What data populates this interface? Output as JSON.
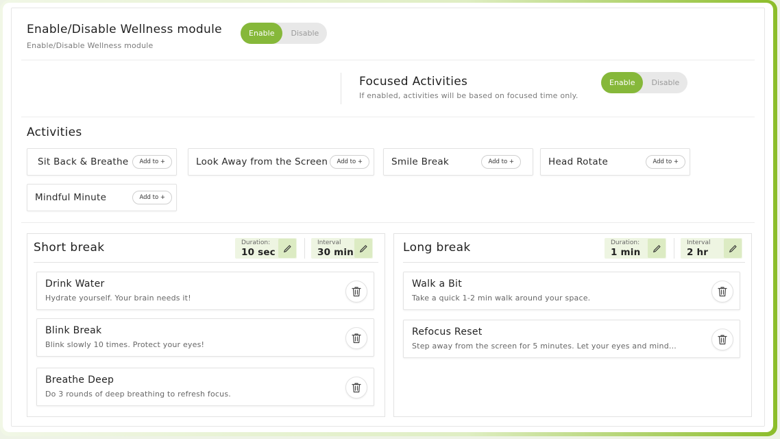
{
  "module": {
    "title": "Enable/Disable Wellness module",
    "subtitle": "Enable/Disable Wellness module",
    "toggle": {
      "enable_label": "Enable",
      "disable_label": "Disable",
      "selected": "Enable"
    }
  },
  "focused": {
    "title": "Focused Activities",
    "subtitle": "If enabled, activities will be based on focused time only.",
    "toggle": {
      "enable_label": "Enable",
      "disable_label": "Disable",
      "selected": "Enable"
    }
  },
  "activities": {
    "heading": "Activities",
    "add_label": "Add to +",
    "items": [
      {
        "label": "Sit Back & Breathe"
      },
      {
        "label": "Look Away from the Screen"
      },
      {
        "label": "Smile Break"
      },
      {
        "label": "Head Rotate"
      },
      {
        "label": "Mindful Minute"
      }
    ]
  },
  "short_break": {
    "title": "Short break",
    "duration_label": "Duration:",
    "duration_value": "10 sec",
    "interval_label": "Interval",
    "interval_value": "30 min",
    "items": [
      {
        "title": "Drink Water",
        "desc": "Hydrate yourself. Your brain needs it!"
      },
      {
        "title": "Blink Break",
        "desc": "Blink slowly 10 times. Protect your eyes!"
      },
      {
        "title": "Breathe Deep",
        "desc": "Do 3 rounds of deep breathing to refresh focus."
      }
    ]
  },
  "long_break": {
    "title": "Long break",
    "duration_label": "Duration:",
    "duration_value": "1 min",
    "interval_label": "Interval",
    "interval_value": "2 hr",
    "items": [
      {
        "title": "Walk a Bit",
        "desc": "Take a quick 1-2 min walk around your space."
      },
      {
        "title": "Refocus Reset",
        "desc": "Step away from the screen for 5 minutes. Let your eyes and mind..."
      }
    ]
  },
  "icons": {
    "edit": "pencil-icon",
    "delete": "trash-icon"
  },
  "colors": {
    "accent": "#86b83a",
    "accent_light": "#eef5e2",
    "accent_edit": "#dcebc3",
    "frame_gradient_end": "#8cbd2a"
  }
}
